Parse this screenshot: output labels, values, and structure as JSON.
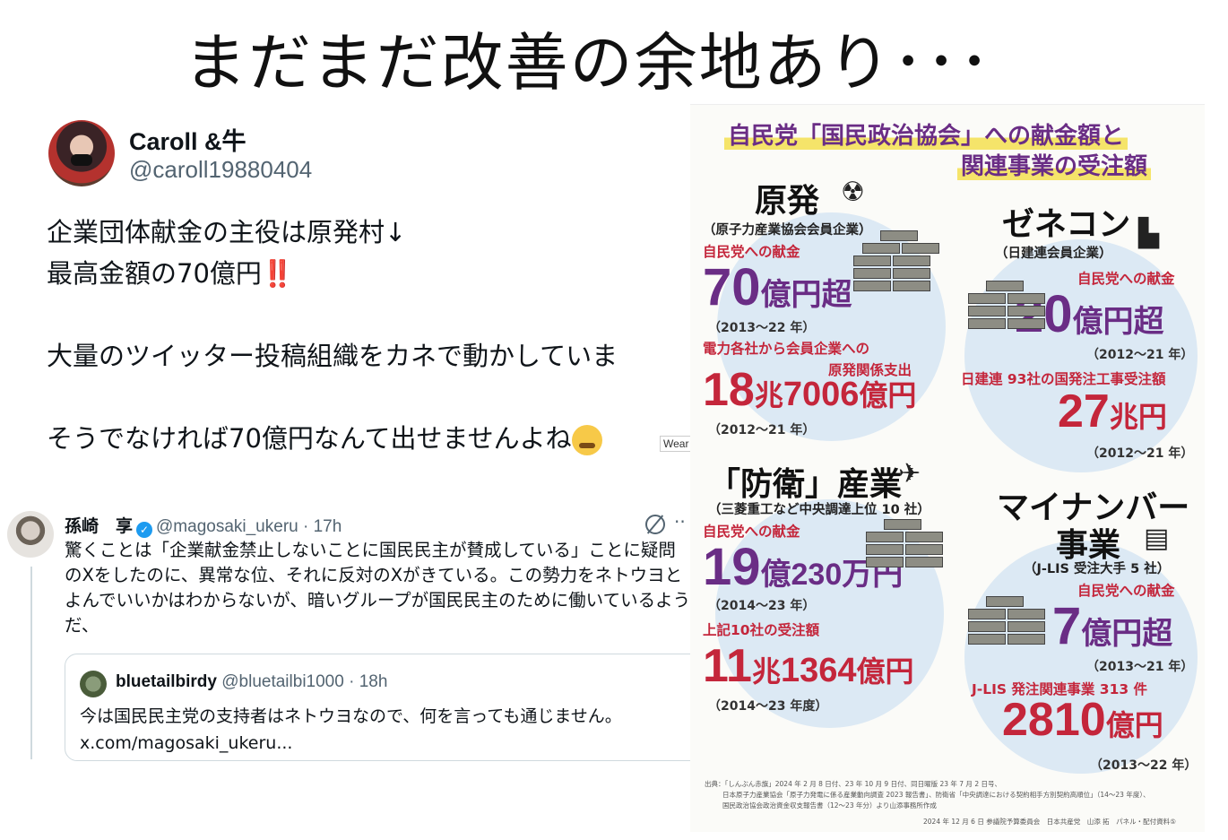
{
  "title": "まだまだ改善の余地あり･･･",
  "tweet": {
    "name": "Caroll &牛",
    "handle": "@caroll19880404",
    "line1": "企業団体献金の主役は原発村↓",
    "line2": "最高金額の70億円",
    "line2_emoji": "‼️",
    "line3": "大量のツイッター投稿組織をカネで動かしていま",
    "line4": "そうでなければ70億円なんて出せませんよね",
    "tag": "Wear"
  },
  "tweet2": {
    "name": "孫崎　享",
    "handle_time": "@magosaki_ukeru · 17h",
    "body": "驚くことは「企業献金禁止しないことに国民民主が賛成している」ことに疑問のXをしたのに、異常な位、それに反対のXがきている。この勢力をネトウヨとよんでいいかはわからないが、暗いグループが国民民主のために働いているようだ、",
    "more": "··",
    "quote": {
      "name": "bluetailbirdy",
      "handle_time": "@bluetailbi1000 · 18h",
      "line1": "今は国民民主党の支持者はネトウヨなので、何を言っても通じません。",
      "line2": "x.com/magosaki_ukeru..."
    }
  },
  "infographic": {
    "heading1": "自民党「国民政治協会」への献金額と",
    "heading2": "関連事業の受注額",
    "nuclear": {
      "title": "原発",
      "sub": "（原子力産業協会会員企業）",
      "donation_label": "自民党への献金",
      "donation_num": "70",
      "donation_unit": "億円超",
      "donation_years": "（2013～22 年）",
      "spend_label1": "電力各社から会員企業への",
      "spend_label2": "原発関係支出",
      "spend_num1": "18",
      "spend_unit1": "兆",
      "spend_num2": "7006",
      "spend_unit2": "億円",
      "spend_years": "（2012～21 年）"
    },
    "zenecon": {
      "title": "ゼネコン",
      "sub": "（日建連会員企業）",
      "donation_label": "自民党への献金",
      "donation_num": "20",
      "donation_unit": "億円超",
      "donation_years": "（2012～21 年）",
      "orders_label": "日建連 93社の国発注工事受注額",
      "orders_num": "27",
      "orders_unit": "兆円",
      "orders_years": "（2012～21 年）"
    },
    "defense": {
      "title": "「防衛」産業",
      "sub": "（三菱重工など中央調達上位 10 社）",
      "donation_label": "自民党への献金",
      "donation_num": "19",
      "donation_unit": "億230万円",
      "donation_years": "（2014～23 年）",
      "orders_label": "上記10社の受注額",
      "orders_num1": "11",
      "orders_unit1": "兆",
      "orders_num2": "1364",
      "orders_unit2": "億円",
      "orders_years": "（2014～23 年度）"
    },
    "mynumber": {
      "title1": "マイナンバー",
      "title2": "事業",
      "sub": "（J-LIS 受注大手 5 社）",
      "donation_label": "自民党への献金",
      "donation_num": "7",
      "donation_unit": "億円超",
      "donation_years": "（2013～21 年）",
      "orders_label": "J-LIS 発注関連事業 313 件",
      "orders_num": "2810",
      "orders_unit": "億円",
      "orders_years": "（2013～22 年）"
    },
    "footer1": "出典：「しんぶん赤旗」2024 年 2 月 8 日付、23 年 10 月 9 日付、同日曜版 23 年 7 月 2 日号、",
    "footer2": "日本原子力産業協会「原子力発電に係る産業動向調査 2023 報告書」、防衛省「中央調達における契約相手方別契約高順位」（14～23 年度）、",
    "footer3": "国民政治協会政治資金収支報告書（12～23 年分）より山添事務所作成",
    "footer4": "2024 年 12 月 6 日 参議院予算委員会　日本共産党　山添 拓　パネル・配付資料⑤"
  }
}
